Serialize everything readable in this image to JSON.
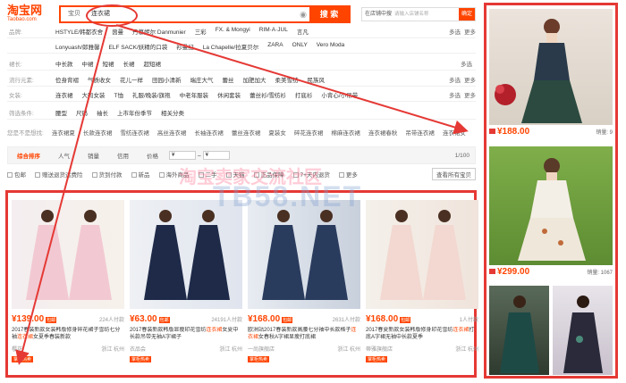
{
  "header": {
    "logo_cn": "淘宝网",
    "logo_en": "Taobao.com",
    "search_tab": "宝贝",
    "query": "连衣裙",
    "search_button": "搜 索",
    "shop_search_label": "在店铺中搜",
    "shop_search_placeholder": "请输入店铺名称",
    "shop_search_button": "确定"
  },
  "filters": [
    {
      "label": "品牌:",
      "options": [
        "HSTYLE/韩都衣舍",
        "茵曼",
        "丹慕妮尔 Danmunier",
        "三彩",
        "FX. & Mongyi",
        "RIM·A·JUL",
        "言凡"
      ],
      "extra": [
        "多选",
        "更多"
      ]
    },
    {
      "label": "",
      "options": [
        "Lonyuash/郎雅馨",
        "ELF SACK/妖精的口袋",
        "衫曼纪",
        "La Chapelle/拉夏贝尔",
        "ZARA",
        "ONLY",
        "Vero Moda"
      ],
      "extra": [
        "",
        ""
      ]
    },
    {
      "label": "裙长:",
      "options": [
        "中长款",
        "中裙",
        "短裙",
        "长裙",
        "超短裙"
      ],
      "extra": [
        "多选",
        ""
      ]
    },
    {
      "label": "流行元素:",
      "options": [
        "俭身背褶",
        "气质收女",
        "花儿一样",
        "田园小清新",
        "端庄大气",
        "蕾丝",
        "加肥加大",
        "柔美雪纺",
        "民族风"
      ],
      "extra": [
        "多选",
        "更多"
      ]
    },
    {
      "label": "女装:",
      "options": [
        "连衣裙",
        "大码女装",
        "T恤",
        "礼服/晚装/旗袍",
        "中老年服装",
        "休闲套装",
        "蕾丝衫/雪纺衫",
        "打底衫",
        "小背心/小吊带"
      ],
      "extra": [
        "多选",
        "更多"
      ]
    },
    {
      "label": "筛选条件:",
      "options": [
        "腰型",
        "尺码",
        "袖长",
        "上市年份季节",
        "相关分类"
      ],
      "extra": [
        "",
        ""
      ]
    }
  ],
  "suggestions": {
    "label": "您是不是想找:",
    "items": [
      "连衣裙夏",
      "长款连衣裙",
      "雪纺连衣裙",
      "高丝连衣裙",
      "长袖连衣裙",
      "蕾丝连衣裙",
      "夏装女",
      "碎花连衣裙",
      "棉麻连衣裙",
      "连衣裙春秋",
      "吊带连衣裙",
      "连衣裙女"
    ]
  },
  "sortbar": {
    "items": [
      "综合排序",
      "人气",
      "销量",
      "信用",
      "价格"
    ],
    "price_from": "¥",
    "price_to": "¥",
    "pager": "1/100"
  },
  "checkboxes": [
    "包邮",
    "赠送退货运费险",
    "货到付款",
    "新品",
    "海外商品",
    "二手",
    "天猫",
    "正品保障",
    "7+天内退货",
    "更多"
  ],
  "check_right": "查看所有宝贝",
  "products": [
    {
      "price": "¥139.00",
      "badge": "包邮",
      "paid": "224人付款",
      "title_pre": "2017春装新款女装韩版修身碎花裙子雪纺七分袖",
      "title_hl": "连衣裙",
      "title_post": "女夏季春装新款",
      "shop": "樱花",
      "loc": "浙江 杭州",
      "tag": "掌柜热卖"
    },
    {
      "price": "¥63.00",
      "badge": "包邮",
      "paid": "24191人付款",
      "title_pre": "2017春装新款韩版显瘦印花雪纺",
      "title_hl": "连衣裙",
      "title_post": "女夏中长款吊带无袖A字裙子",
      "shop": "衣品会",
      "loc": "浙江 杭州",
      "tag": "掌柜热卖"
    },
    {
      "price": "¥168.00",
      "badge": "包邮",
      "paid": "2631人付款",
      "title_pre": "欧洲站2017春装新款高腰七分袖中长款格子",
      "title_hl": "连衣裙",
      "title_post": "女春秋A字裙显瘦打底裙",
      "shop": "一尚旗舰店",
      "loc": "浙江 杭州",
      "tag": "掌柜热卖"
    },
    {
      "price": "¥168.00",
      "badge": "包邮",
      "paid": "1人付款",
      "title_pre": "2017春夏新款女装韩版修身印花雪纺",
      "title_hl": "连衣裙",
      "title_post": "打底A字裙无袖中长款夏季",
      "shop": "蒂雅旗舰店",
      "loc": "浙江 杭州",
      "tag": "掌柜热卖"
    }
  ],
  "sidebar": [
    {
      "price": "¥188.00",
      "sales": "销量: 9"
    },
    {
      "price": "¥299.00",
      "sales": "销量: 1067"
    }
  ],
  "watermark": "淘宝卖家交流社区",
  "watermark_brand": "TB58.NET",
  "colors": {
    "accent": "#ff4400",
    "annotation": "#e53935"
  }
}
